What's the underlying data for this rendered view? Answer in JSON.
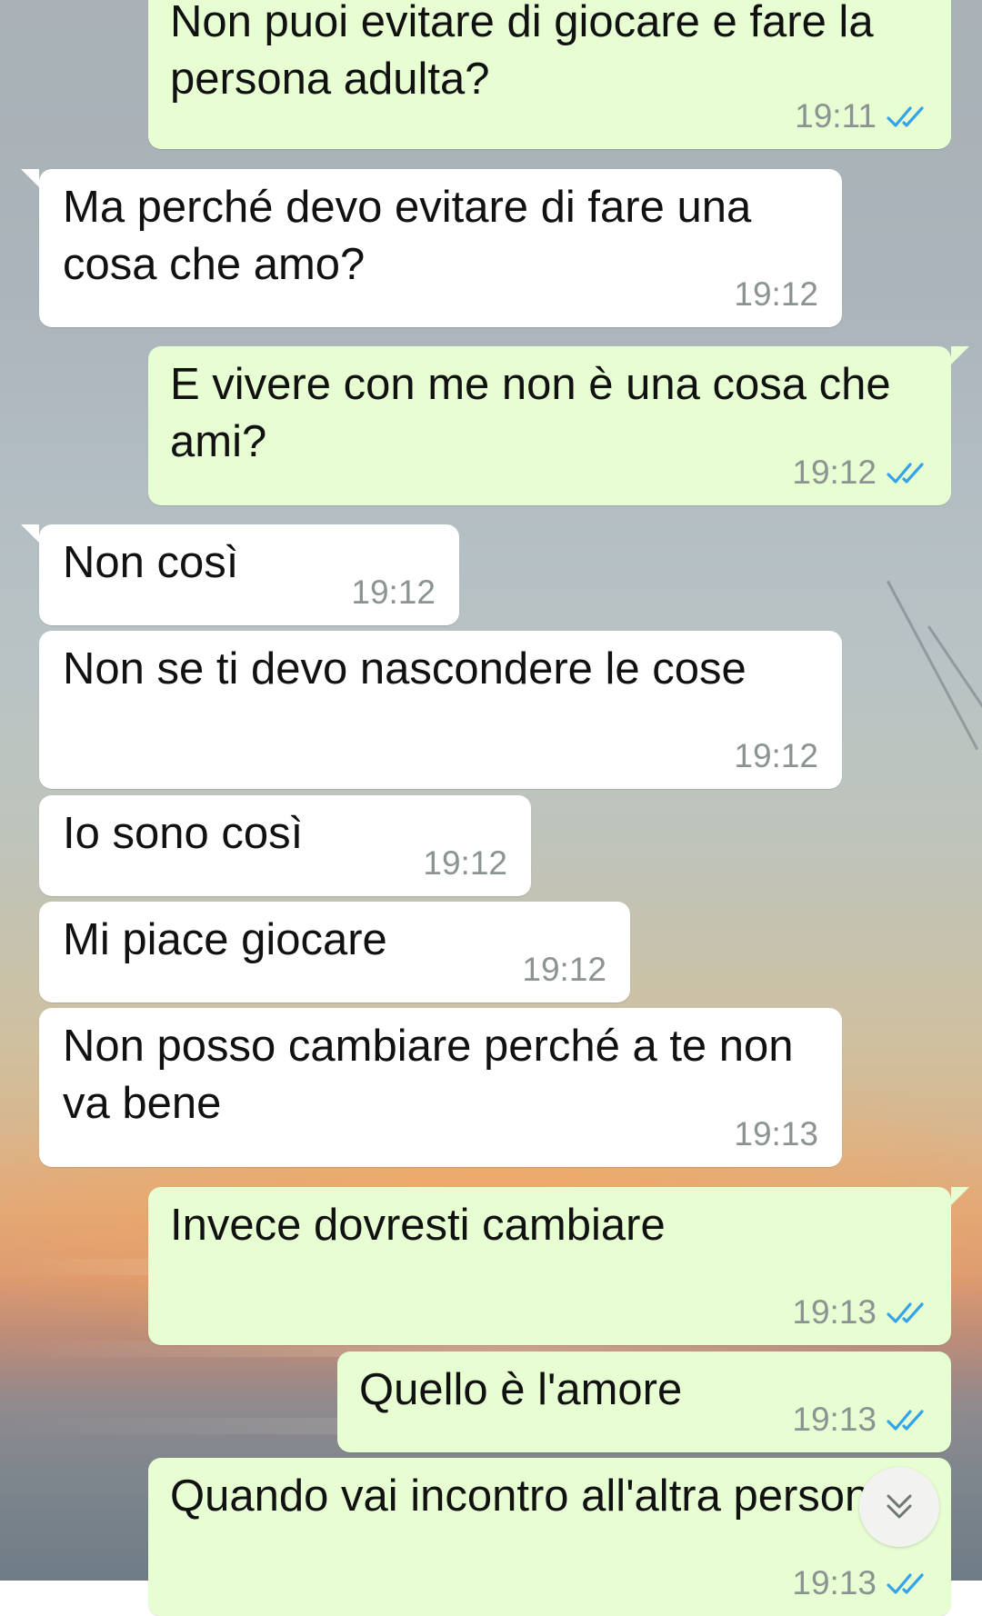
{
  "messages": [
    {
      "dir": "out",
      "text": "Non puoi evitare di giocare e fare la persona adulta?",
      "time": "19:11",
      "read": true
    },
    {
      "dir": "in",
      "text": "Ma perché devo evitare di fare una cosa che amo?",
      "time": "19:12"
    },
    {
      "dir": "out",
      "text": "E vivere con me non è una cosa che ami?",
      "time": "19:12",
      "read": true
    },
    {
      "dir": "in",
      "text": "Non così",
      "time": "19:12"
    },
    {
      "dir": "in",
      "text": "Non se ti devo nascondere le cose",
      "time": "19:12"
    },
    {
      "dir": "in",
      "text": "Io sono così",
      "time": "19:12"
    },
    {
      "dir": "in",
      "text": "Mi piace giocare",
      "time": "19:12"
    },
    {
      "dir": "in",
      "text": "Non posso cambiare perché a te non va bene",
      "time": "19:13"
    },
    {
      "dir": "out",
      "text": "Invece dovresti cambiare",
      "time": "19:13",
      "read": true
    },
    {
      "dir": "out",
      "text": "Quello è l'amore",
      "time": "19:13",
      "read": true
    },
    {
      "dir": "out",
      "text": "Quando vai incontro all'altra persona",
      "time": "19:13",
      "read": true
    }
  ],
  "colors": {
    "outgoing_bubble": "#e7fed2",
    "incoming_bubble": "#ffffff",
    "read_ticks": "#34a3e8",
    "timestamp": "#8b9393"
  },
  "icons": {
    "read_receipt": "double-check-icon",
    "scroll_down": "chevron-double-down-icon"
  }
}
